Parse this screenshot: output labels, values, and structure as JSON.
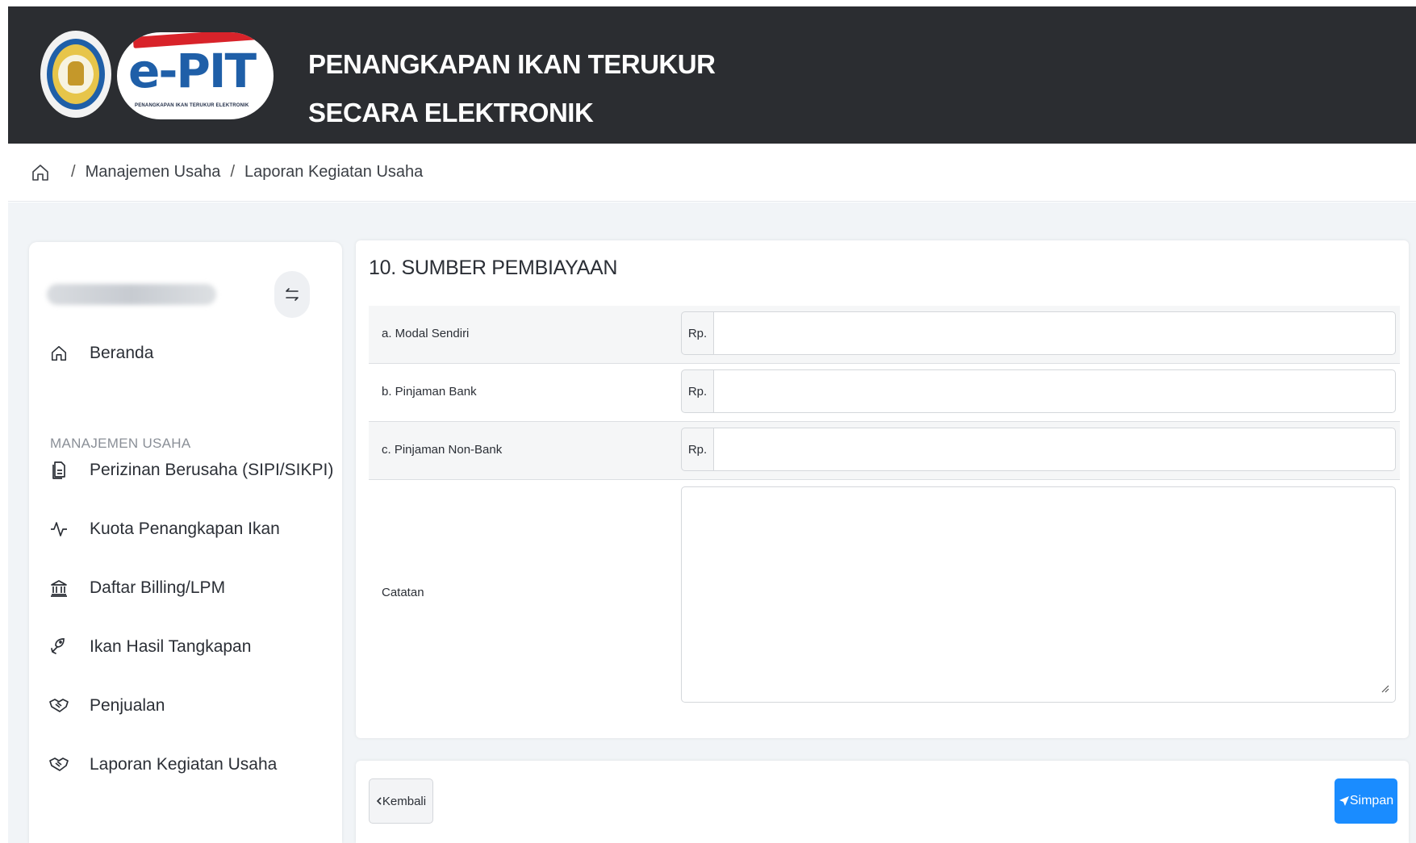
{
  "header": {
    "logo_seal_icon": "ministry-seal-logo",
    "logo_word": "e-PIT",
    "logo_subtitle": "PENANGKAPAN IKAN TERUKUR ELEKTRONIK",
    "title_line1": "PENANGKAPAN IKAN TERUKUR",
    "title_line2": "SECARA ELEKTRONIK",
    "background_color": "#2b2d31"
  },
  "breadcrumb": {
    "home_icon": "home-icon",
    "items": [
      "Manajemen Usaha",
      "Laporan Kegiatan Usaha"
    ],
    "separator": "/"
  },
  "sidebar": {
    "toggle_icon": "swap-arrows-icon",
    "items": [
      {
        "label": "Beranda",
        "icon": "home-icon"
      },
      {
        "label": "Perizinan Berusaha (SIPI/SIKPI)",
        "icon": "document-icon"
      },
      {
        "label": "Kuota Penangkapan Ikan",
        "icon": "activity-icon"
      },
      {
        "label": "Daftar Billing/LPM",
        "icon": "bank-icon"
      },
      {
        "label": "Ikan Hasil Tangkapan",
        "icon": "fish-icon"
      },
      {
        "label": "Penjualan",
        "icon": "handshake-icon"
      },
      {
        "label": "Laporan Kegiatan Usaha",
        "icon": "handshake-icon"
      }
    ],
    "section_label": "MANAJEMEN USAHA"
  },
  "form": {
    "section_title": "10. SUMBER PEMBIAYAAN",
    "currency_prefix": "Rp.",
    "fields": [
      {
        "label": "a. Modal Sendiri",
        "value": ""
      },
      {
        "label": "b. Pinjaman Bank",
        "value": ""
      },
      {
        "label": "c. Pinjaman Non-Bank",
        "value": ""
      }
    ],
    "notes_label": "Catatan",
    "notes_value": ""
  },
  "footer": {
    "back_label": "Kembali",
    "save_label": "Simpan",
    "back_icon": "chevron-left-icon",
    "save_icon": "send-icon",
    "save_color": "#1a8cff"
  }
}
